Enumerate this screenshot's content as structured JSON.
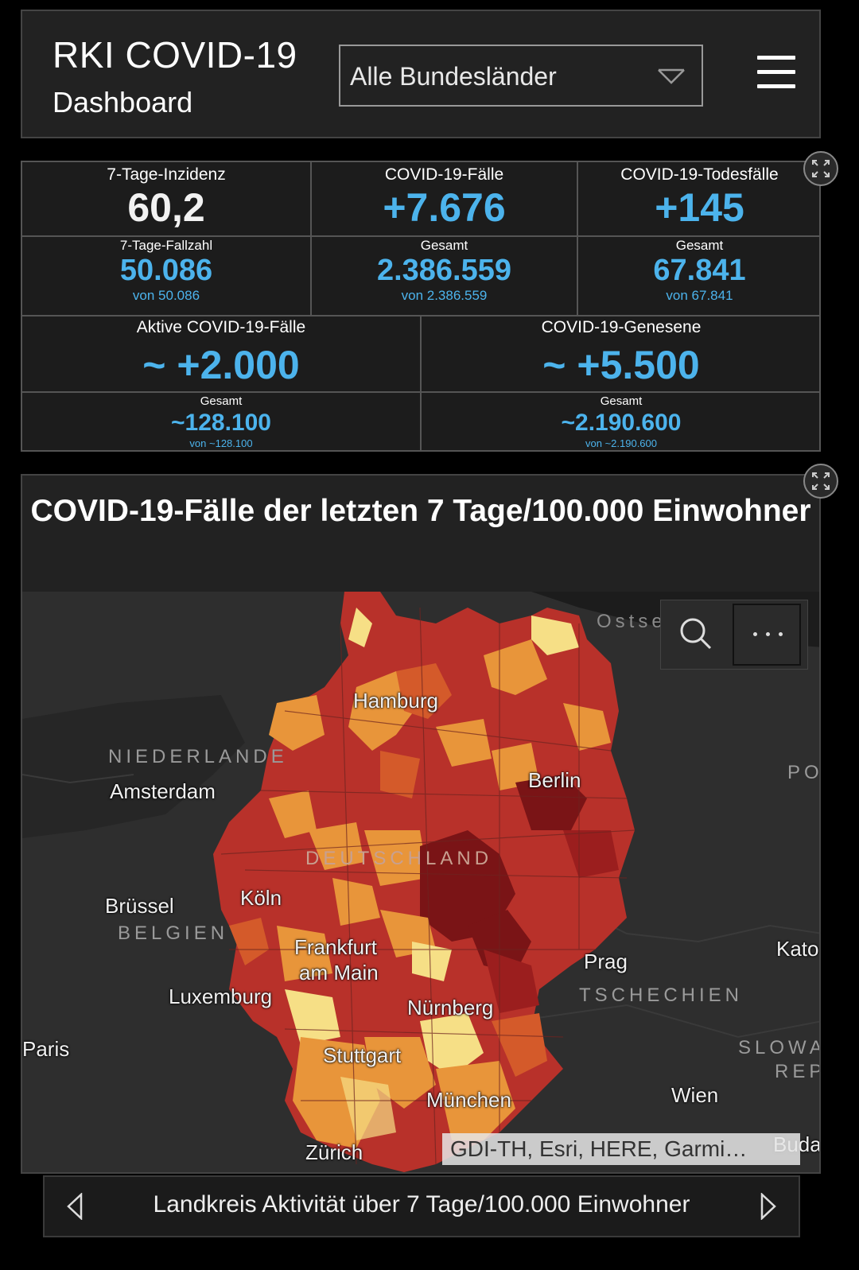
{
  "header": {
    "title": "RKI COVID-19",
    "subtitle": "Dashboard",
    "region_select": {
      "value": "Alle Bundesländer",
      "icon": "chevron-down-icon"
    },
    "menu_icon": "hamburger-menu-icon"
  },
  "stats": {
    "incidence": {
      "label": "7-Tage-Inzidenz",
      "value": "60,2"
    },
    "cases": {
      "label": "COVID-19-Fälle",
      "value": "+7.676"
    },
    "deaths": {
      "label": "COVID-19-Todesfälle",
      "value": "+145"
    },
    "weekly_cases": {
      "label": "7-Tage-Fallzahl",
      "value": "50.086",
      "sub": "von 50.086"
    },
    "cases_total": {
      "label": "Gesamt",
      "value": "2.386.559",
      "sub": "von 2.386.559"
    },
    "deaths_total": {
      "label": "Gesamt",
      "value": "67.841",
      "sub": "von 67.841"
    },
    "active": {
      "label": "Aktive COVID-19-Fälle",
      "value": "~ +2.000"
    },
    "recovered": {
      "label": "COVID-19-Genesene",
      "value": "~ +5.500"
    },
    "active_total": {
      "label": "Gesamt",
      "value": "~128.100",
      "sub": "von ~128.100"
    },
    "recovered_total": {
      "label": "Gesamt",
      "value": "~2.190.600",
      "sub": "von ~2.190.600"
    },
    "expand_icon": "expand-icon"
  },
  "map": {
    "title": "COVID-19-Fälle der letzten 7 Tage/100.000 Einwohner",
    "labels": {
      "ostsee": "Ostse",
      "niederlande": "NIEDERLANDE",
      "amsterdam": "Amsterdam",
      "hamburg": "Hamburg",
      "berlin": "Berlin",
      "po": "PO",
      "deutschland": "DEUTSCHLAND",
      "bruessel": "Brüssel",
      "belgien": "BELGIEN",
      "koeln": "Köln",
      "frankfurt": "Frankfurt",
      "am_main": "am Main",
      "prag": "Prag",
      "kato": "Kato",
      "tschechien": "TSCHECHIEN",
      "luxemburg": "Luxemburg",
      "nuernberg": "Nürnberg",
      "paris": "Paris",
      "slowa": "SLOWA",
      "rep": "REP",
      "stuttgart": "Stuttgart",
      "wien": "Wien",
      "muenchen": "München",
      "zuerich": "Zürich",
      "buda": "Buda"
    },
    "attribution": "GDI-TH, Esri, HERE, Garmi…",
    "tools": {
      "search_icon": "search-icon",
      "more_icon": "more-options-icon"
    },
    "colors": {
      "dark_red": "#7a1416",
      "red": "#b8312a",
      "orange_red": "#d45a2a",
      "orange": "#e8953a",
      "yellow": "#f6df86"
    }
  },
  "footer": {
    "text": "Landkreis Aktivität über 7 Tage/100.000 Einwohner",
    "prev_icon": "chevron-left-icon",
    "next_icon": "chevron-right-icon"
  }
}
